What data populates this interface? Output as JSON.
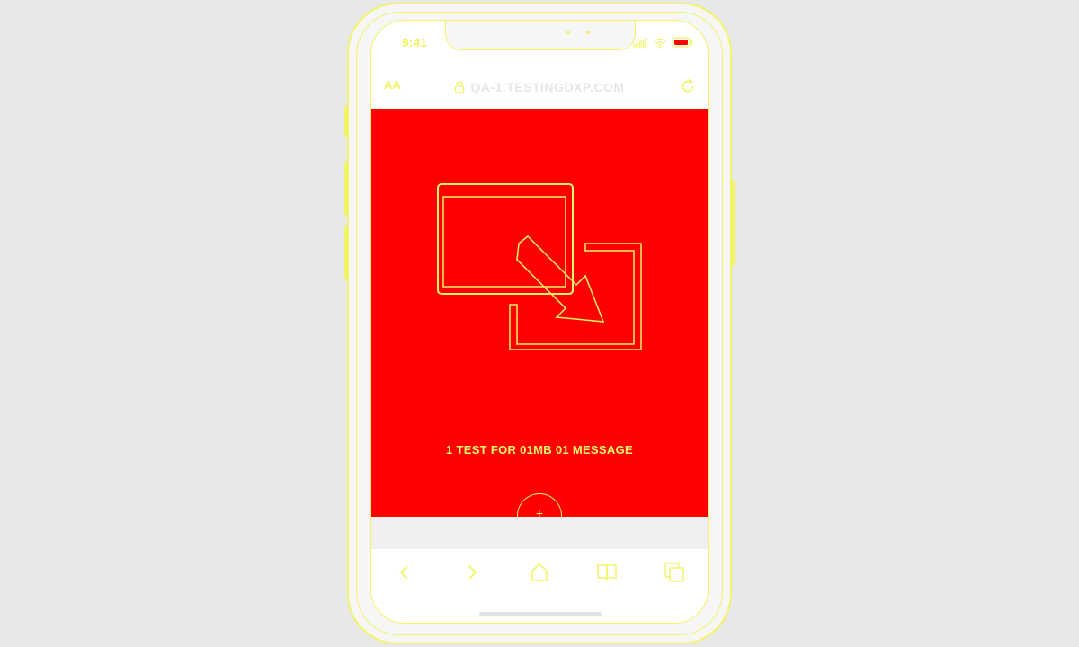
{
  "status_bar": {
    "time": "9:41",
    "icons": [
      "signal-icon",
      "wifi-icon",
      "battery-icon"
    ]
  },
  "browser": {
    "text_size_label": "AA",
    "url": "QA-1.TESTINGDXP.COM",
    "lock_icon": "lock-icon",
    "reload_icon": "reload-icon"
  },
  "content": {
    "background_color": "#ff0000",
    "hero_icon": "picture-in-picture-icon",
    "message": "1 TEST FOR 01MB 01 MESSAGE",
    "fab_icon": "plus-icon"
  },
  "toolbar": {
    "items": [
      "back-icon",
      "forward-icon",
      "share-icon",
      "bookmarks-icon",
      "tabs-icon"
    ]
  },
  "colors": {
    "outline": "#f3f367",
    "backdrop": "#e8e8e8"
  }
}
